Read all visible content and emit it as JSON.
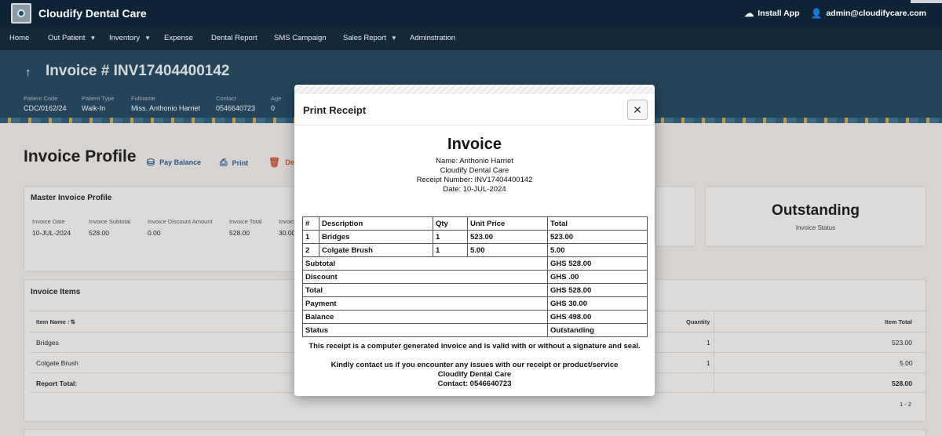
{
  "app": {
    "title": "Cloudify Dental Care"
  },
  "topbar": {
    "install_label": "Install App",
    "user_email": "admin@cloudifycare.com"
  },
  "nav": [
    {
      "label": "Home",
      "dropdown": false
    },
    {
      "label": "Out Patient",
      "dropdown": true
    },
    {
      "label": "Inventory",
      "dropdown": true
    },
    {
      "label": "Expense",
      "dropdown": false
    },
    {
      "label": "Dental Report",
      "dropdown": false
    },
    {
      "label": "SMS Campaign",
      "dropdown": false
    },
    {
      "label": "Sales Report",
      "dropdown": true
    },
    {
      "label": "Adminstration",
      "dropdown": false
    }
  ],
  "invoice_header": {
    "title": "Invoice # INV17404400142",
    "fields": [
      {
        "label": "Patient Code",
        "value": "CDC/0162/24"
      },
      {
        "label": "Patient Type",
        "value": "Walk-In"
      },
      {
        "label": "Fullname",
        "value": "Miss. Anthonio Harriet"
      },
      {
        "label": "Contact",
        "value": "0546640723"
      },
      {
        "label": "Age",
        "value": "0"
      }
    ]
  },
  "profile": {
    "title": "Invoice Profile",
    "actions": {
      "pay_balance": "Pay Balance",
      "print": "Print",
      "delete": "Delete"
    }
  },
  "master": {
    "title": "Master Invoice Profile",
    "fields": [
      {
        "label": "Invoice Date",
        "value": "10-JUL-2024"
      },
      {
        "label": "Invoice Subtotal",
        "value": "528.00"
      },
      {
        "label": "Invoice Discount Amount",
        "value": "0.00"
      },
      {
        "label": "Invoice Total",
        "value": "528.00"
      },
      {
        "label": "Invoice Payment",
        "value": "30.00"
      }
    ]
  },
  "status_card": {
    "value": "Outstanding",
    "label": "Invoice Status"
  },
  "items": {
    "title": "Invoice Items",
    "headers": {
      "name": "Item Name",
      "quantity": "Quantity",
      "total": "Item Total"
    },
    "rows": [
      {
        "name": "Bridges",
        "quantity": "1",
        "total": "523.00"
      },
      {
        "name": "Colgate Brush",
        "quantity": "1",
        "total": "5.00"
      }
    ],
    "report_total_label": "Report Total:",
    "report_total_value": "528.00",
    "pagination": "1 - 2"
  },
  "modal": {
    "title": "Print Receipt",
    "receipt": {
      "heading": "Invoice",
      "name_line": "Name: Anthonio Harriet",
      "clinic": "Cloudify Dental Care",
      "receipt_number_line": "Receipt Number: INV17404400142",
      "date_line": "Date: 10-JUL-2024",
      "table_headers": {
        "num": "#",
        "description": "Description",
        "qty": "Qty",
        "unit_price": "Unit Price",
        "total": "Total"
      },
      "lines": [
        {
          "num": "1",
          "description": "Bridges",
          "qty": "1",
          "unit_price": "523.00",
          "total": "523.00"
        },
        {
          "num": "2",
          "description": "Colgate Brush",
          "qty": "1",
          "unit_price": "5.00",
          "total": "5.00"
        }
      ],
      "summary": [
        {
          "label": "Subtotal",
          "value": "GHS 528.00"
        },
        {
          "label": "Discount",
          "value": "GHS .00"
        },
        {
          "label": "Total",
          "value": "GHS 528.00"
        },
        {
          "label": "Payment",
          "value": "GHS 30.00"
        },
        {
          "label": "Balance",
          "value": "GHS 498.00"
        },
        {
          "label": "Status",
          "value": "Outstanding"
        }
      ],
      "footer_line1": "This receipt is a computer generated invoice and is valid with or without a signature and seal.",
      "footer_line2": "Kindly contact us if you encounter any issues with our receipt or product/service",
      "footer_clinic": "Cloudify Dental Care",
      "footer_contact": "Contact: 0546640723"
    }
  }
}
